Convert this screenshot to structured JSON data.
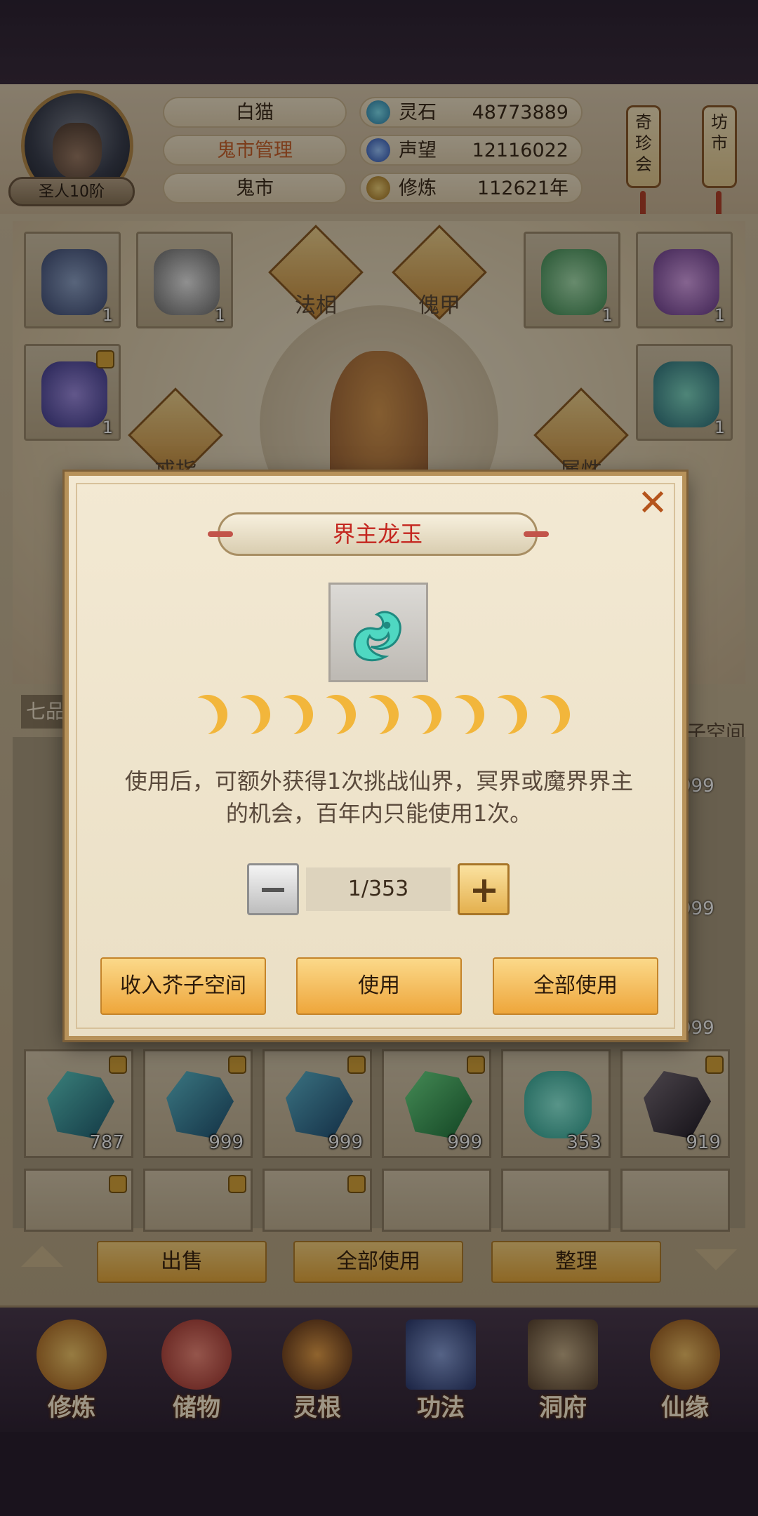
{
  "header": {
    "rank": "圣人10阶",
    "name": "白猫",
    "title": "鬼市管理",
    "location": "鬼市",
    "resources": [
      {
        "icon": "spirit-stone-icon",
        "label": "灵石",
        "value": "48773889"
      },
      {
        "icon": "reputation-icon",
        "label": "声望",
        "value": "12116022"
      },
      {
        "icon": "cultivation-icon",
        "label": "修炼",
        "value": "112621年"
      }
    ],
    "scrolls": [
      "奇珍会",
      "坊市"
    ]
  },
  "equipment": {
    "slot_labels": [
      "法相",
      "傀甲",
      "戒指",
      "属性"
    ],
    "counts": [
      "1",
      "1",
      "1",
      "1",
      "1",
      "1"
    ],
    "side_tag": "七品",
    "space_label": "芥子空间"
  },
  "grid": {
    "row_counts": [
      "787",
      "999",
      "999",
      "999",
      "353",
      "919"
    ],
    "side_counts": [
      "999",
      "999",
      "999"
    ]
  },
  "bottom_buttons": [
    "出售",
    "全部使用",
    "整理"
  ],
  "nav": [
    {
      "label": "修炼",
      "icon": "monk-icon"
    },
    {
      "label": "储物",
      "icon": "bag-icon"
    },
    {
      "label": "灵根",
      "icon": "spirit-root-icon"
    },
    {
      "label": "功法",
      "icon": "book-icon"
    },
    {
      "label": "洞府",
      "icon": "cave-house-icon"
    },
    {
      "label": "仙缘",
      "icon": "gourd-icon"
    }
  ],
  "dialog": {
    "title": "界主龙玉",
    "item_icon": "dragon-jade-icon",
    "stars": 9,
    "description_line1": "使用后，可额外获得1次挑战仙界，冥界或魔界界主",
    "description_line2": "的机会，百年内只能使用1次。",
    "quantity": "1/353",
    "buttons": {
      "store": "收入芥子空间",
      "use": "使用",
      "use_all": "全部使用"
    },
    "close_symbol": "✕"
  },
  "colors": {
    "accent_gold": "#eea63b",
    "title_red": "#c4261f",
    "highlight_orange": "#c8612a"
  }
}
